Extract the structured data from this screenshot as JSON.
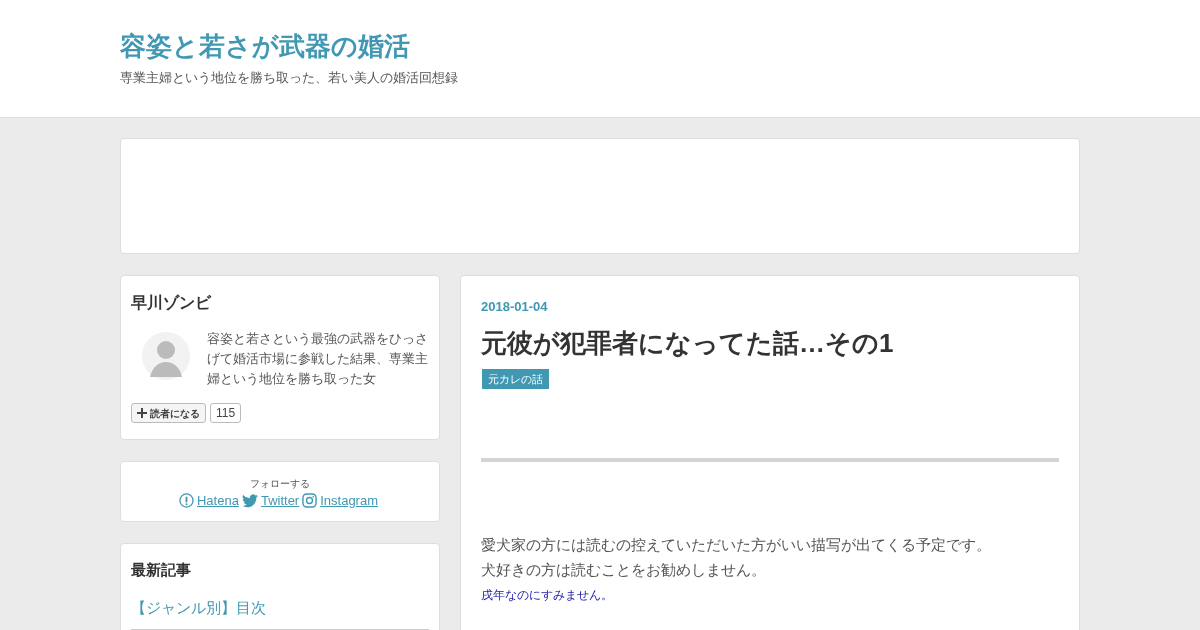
{
  "header": {
    "title": "容姿と若さが武器の婚活",
    "subtitle": "専業主婦という地位を勝ち取った、若い美人の婚活回想録"
  },
  "profile": {
    "name": "早川ゾンビ",
    "bio": "容姿と若さという最強の武器をひっさげて婚活市場に参戦した結果、専業主婦という地位を勝ち取った女",
    "subscribe_label": "読者になる",
    "subscriber_count": "115"
  },
  "follow": {
    "label": "フォローする",
    "links": [
      {
        "kind": "hatena",
        "label": "Hatena"
      },
      {
        "kind": "twitter",
        "label": "Twitter"
      },
      {
        "kind": "instagram",
        "label": "Instagram"
      }
    ]
  },
  "recent": {
    "title": "最新記事",
    "items": [
      "【ジャンル別】目次"
    ]
  },
  "article": {
    "date": "2018-01-04",
    "title": "元彼が犯罪者になってた話…その1",
    "category": "元カレの話",
    "paragraphs": [
      {
        "kind": "normal",
        "text": "愛犬家の方には読むの控えていただいた方がいい描写が出てくる予定です。"
      },
      {
        "kind": "normal",
        "text": "犬好きの方は読むことをお勧めしません。"
      },
      {
        "kind": "note",
        "text": "戌年なのにすみません。"
      }
    ]
  }
}
